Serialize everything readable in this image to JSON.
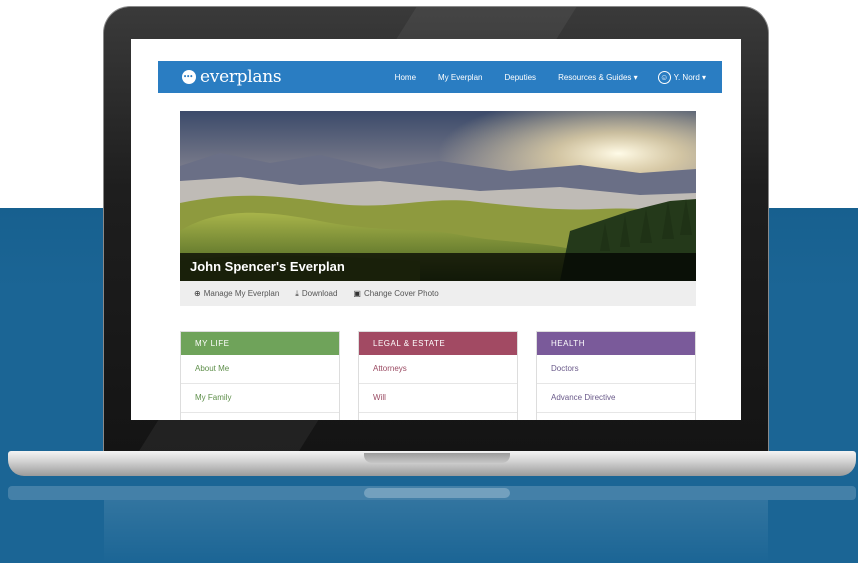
{
  "nav": {
    "logo": "everplans",
    "links": [
      "Home",
      "My Everplan",
      "Deputies",
      "Resources & Guides ▾"
    ],
    "user": "Y. Nord ▾"
  },
  "cover": {
    "title": "John Spencer's Everplan"
  },
  "actions": [
    {
      "icon": "plus-circle-icon",
      "label": "Manage My Everplan"
    },
    {
      "icon": "download-icon",
      "label": "Download"
    },
    {
      "icon": "image-icon",
      "label": "Change Cover Photo"
    }
  ],
  "cards": [
    {
      "title": "MY LIFE",
      "color": "#6fa35a",
      "items": [
        "About Me",
        "My Family"
      ]
    },
    {
      "title": "LEGAL & ESTATE",
      "color": "#a24a63",
      "items": [
        "Attorneys",
        "Will"
      ]
    },
    {
      "title": "HEALTH",
      "color": "#7a5a9a",
      "items": [
        "Doctors",
        "Advance Directive"
      ]
    }
  ],
  "colors": {
    "nav": "#2a7dc2",
    "background_band": "#1b6595"
  }
}
